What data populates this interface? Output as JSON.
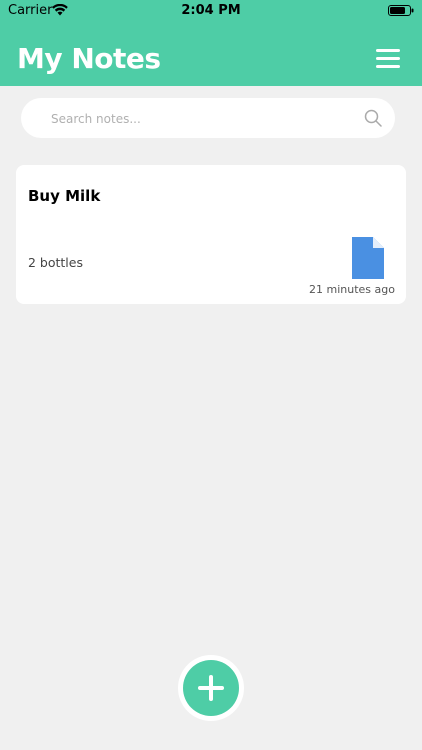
{
  "status_bar": {
    "carrier": "Carrier",
    "time": "2:04 PM"
  },
  "header": {
    "title": "My Notes",
    "menu_icon": "hamburger-menu-icon",
    "background_color": "#4ecda6"
  },
  "search": {
    "placeholder": "Search notes...",
    "value": "",
    "icon": "search-icon"
  },
  "notes": [
    {
      "title": "Buy Milk",
      "body": "2 bottles",
      "time": "21 minutes ago",
      "icon": "document-icon",
      "icon_color": "#4a90e2"
    }
  ],
  "fab": {
    "icon": "plus-icon",
    "color": "#4ecda6"
  }
}
